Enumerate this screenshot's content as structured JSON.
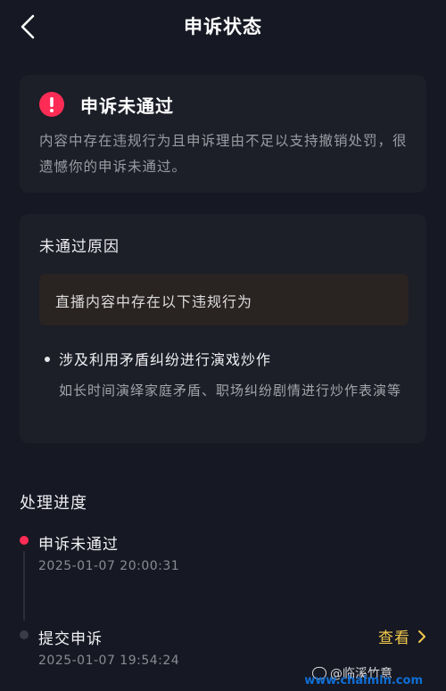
{
  "header": {
    "title": "申诉状态"
  },
  "status": {
    "title": "申诉未通过",
    "description": "内容中存在违规行为且申诉理由不足以支持撤销处罚，很遗憾你的申诉未通过。"
  },
  "reason": {
    "title": "未通过原因",
    "box_text": "直播内容中存在以下违规行为",
    "violation_title": "涉及利用矛盾纠纷进行演戏炒作",
    "violation_desc": "如长时间演绎家庭矛盾、职场纠纷剧情进行炒作表演等"
  },
  "progress": {
    "title": "处理进度",
    "steps": [
      {
        "label": "申诉未通过",
        "time": "2025-01-07 20:00:31"
      },
      {
        "label": "提交申诉",
        "time": "2025-01-07 19:54:24"
      }
    ],
    "view_label": "查看"
  },
  "watermark": {
    "author": "@临溪竹意",
    "url": "www.chalmin.com"
  },
  "colors": {
    "background": "#161823",
    "card": "#1c1e28",
    "alert_red": "#fe2c55",
    "link_yellow": "#f2c94c"
  },
  "icons": {
    "back": "chevron-left-icon",
    "alert": "exclamation-circle-icon",
    "view": "chevron-right-icon"
  }
}
